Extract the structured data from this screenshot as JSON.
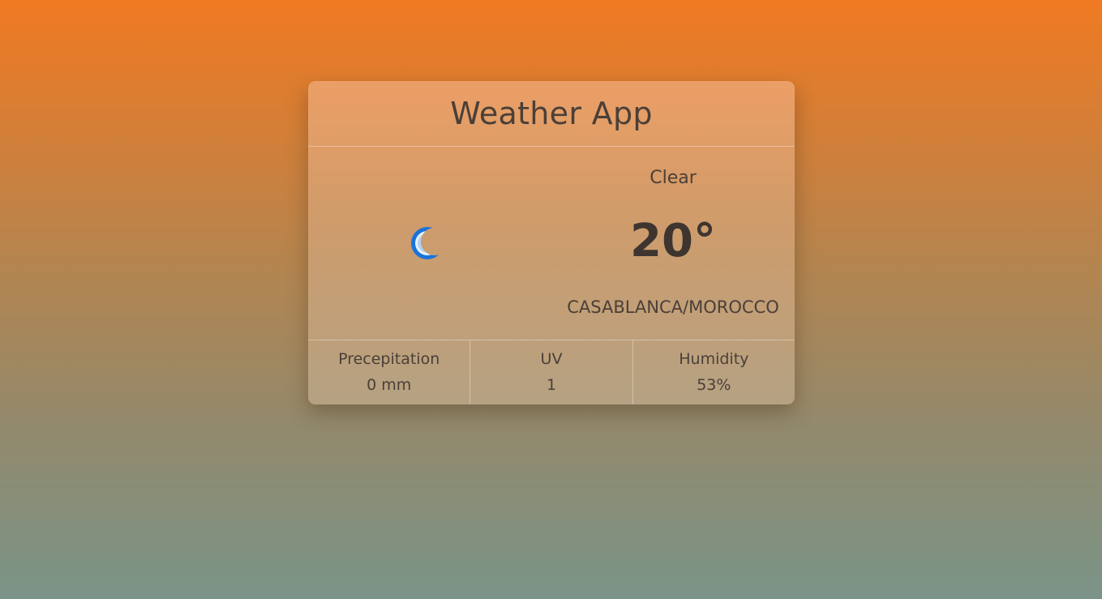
{
  "app": {
    "title": "Weather App"
  },
  "current": {
    "condition": "Clear",
    "temperature": "20°",
    "location": "CASABLANCA/MOROCCO",
    "icon": "moon-icon",
    "icon_color": "#1a73d9"
  },
  "stats": [
    {
      "label": "Precepitation",
      "value": "0 mm"
    },
    {
      "label": "UV",
      "value": "1"
    },
    {
      "label": "Humidity",
      "value": "53%"
    }
  ],
  "colors": {
    "background_top": "#f07a22",
    "background_bottom": "#7a9488",
    "text": "#4a3f38"
  }
}
